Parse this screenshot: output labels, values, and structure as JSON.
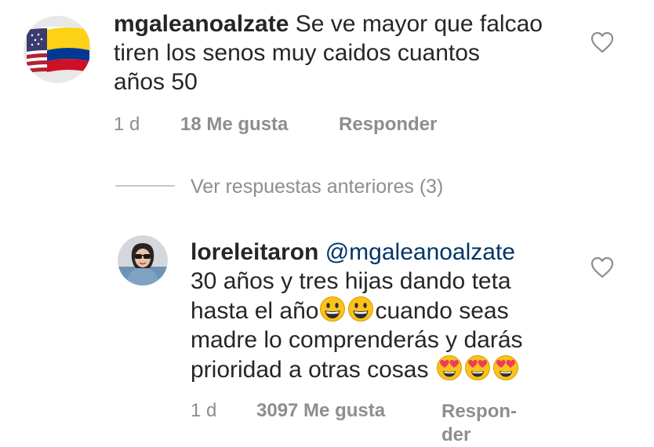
{
  "comment1": {
    "username": "mgaleanoalzate",
    "text_lines": [
      "Se ve mayor que falcao",
      "tiren los senos muy caidos cuantos",
      "años 50"
    ],
    "age": "1 d",
    "likes": "18 Me gusta",
    "reply_label": "Responder",
    "avatar_icon": "us-colombia-flag-avatar",
    "like_icon": "heart-outline-icon"
  },
  "view_replies": {
    "label": "Ver respuestas anteriores (3)"
  },
  "comment2": {
    "username": "loreleitaron",
    "mention": "@mgaleanoalzate",
    "line1": "30 años y tres hijas dando teta",
    "line2a": "hasta el año",
    "line2b": "cuando seas",
    "line3": "madre lo comprenderás y darás",
    "line4": "prioridad a otras cosas",
    "age": "1 d",
    "likes": "3097 Me gusta",
    "reply_label_1": "Respon-",
    "reply_label_2": "der",
    "avatar_icon": "profile-photo-avatar",
    "like_icon": "heart-outline-icon",
    "emoji_icons": [
      "grinning-face-emoji",
      "grinning-face-emoji",
      "heart-eyes-emoji",
      "heart-eyes-emoji",
      "heart-eyes-emoji"
    ]
  },
  "colors": {
    "text": "#262626",
    "muted": "#8e8e8e",
    "mention": "#003569",
    "divider": "#c7c7c7"
  }
}
